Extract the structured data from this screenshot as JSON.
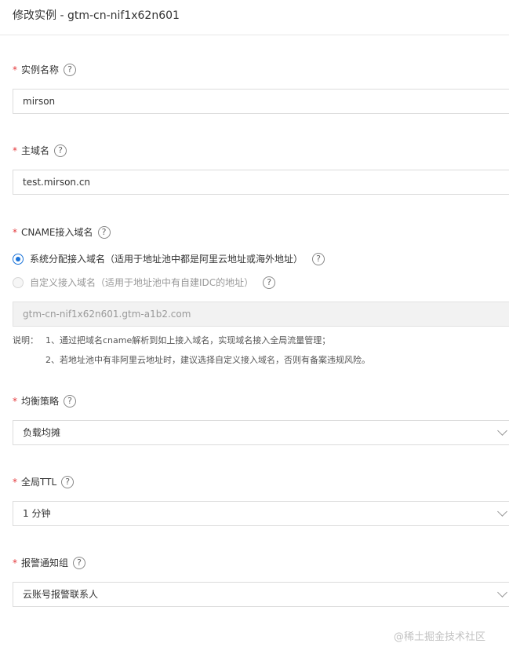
{
  "header": {
    "title": "修改实例 - gtm-cn-nif1x62n601"
  },
  "instance_name": {
    "label": "实例名称",
    "value": "mirson"
  },
  "main_domain": {
    "label": "主域名",
    "value": "test.mirson.cn"
  },
  "cname": {
    "label": "CNAME接入域名",
    "options": [
      {
        "label": "系统分配接入域名（适用于地址池中都是阿里云地址或海外地址）",
        "checked": true
      },
      {
        "label": "自定义接入域名（适用于地址池中有自建IDC的地址）",
        "checked": false
      }
    ],
    "placeholder": "gtm-cn-nif1x62n601.gtm-a1b2.com"
  },
  "notes": {
    "prefix": "说明：",
    "items": [
      "1、通过把域名cname解析到如上接入域名，实现域名接入全局流量管理；",
      "2、若地址池中有非阿里云地址时，建议选择自定义接入域名，否则有备案违规风险。"
    ]
  },
  "strategy": {
    "label": "均衡策略",
    "value": "负载均摊"
  },
  "ttl": {
    "label": "全局TTL",
    "value": "1 分钟"
  },
  "alarm": {
    "label": "报警通知组",
    "value": "云账号报警联系人"
  },
  "watermark": "@稀土掘金技术社区",
  "colors": {
    "accent": "#1a73d9",
    "required": "#e4393c"
  }
}
